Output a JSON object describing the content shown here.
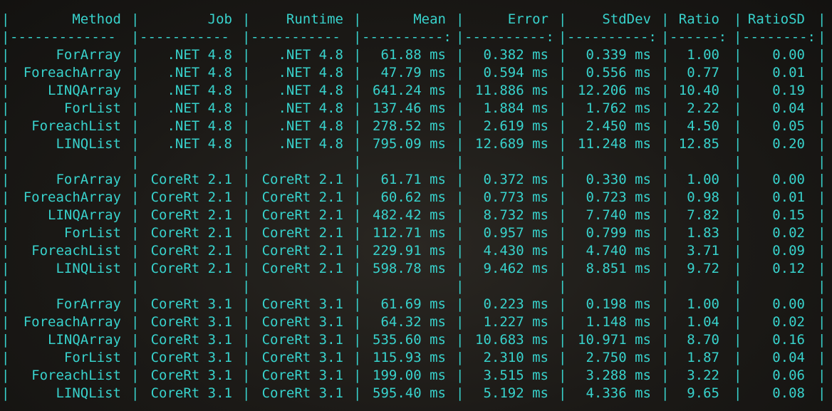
{
  "accent_color": "#38d2cc",
  "columns": [
    {
      "key": "method",
      "label": "Method",
      "separator": "-------------"
    },
    {
      "key": "job",
      "label": "Job",
      "separator": "-----------"
    },
    {
      "key": "runtime",
      "label": "Runtime",
      "separator": "-----------"
    },
    {
      "key": "mean",
      "label": "Mean",
      "separator": "----------:"
    },
    {
      "key": "error",
      "label": "Error",
      "separator": "----------:"
    },
    {
      "key": "stddev",
      "label": "StdDev",
      "separator": "----------:"
    },
    {
      "key": "ratio",
      "label": "Ratio",
      "separator": "------:"
    },
    {
      "key": "ratiosd",
      "label": "RatioSD",
      "separator": "--------:"
    }
  ],
  "groups": [
    {
      "rows": [
        {
          "method": "ForArray",
          "job": ".NET 4.8",
          "runtime": ".NET 4.8",
          "mean": "61.88 ms",
          "error": "0.382 ms",
          "stddev": "0.339 ms",
          "ratio": "1.00",
          "ratiosd": "0.00"
        },
        {
          "method": "ForeachArray",
          "job": ".NET 4.8",
          "runtime": ".NET 4.8",
          "mean": "47.79 ms",
          "error": "0.594 ms",
          "stddev": "0.556 ms",
          "ratio": "0.77",
          "ratiosd": "0.01"
        },
        {
          "method": "LINQArray",
          "job": ".NET 4.8",
          "runtime": ".NET 4.8",
          "mean": "641.24 ms",
          "error": "11.886 ms",
          "stddev": "12.206 ms",
          "ratio": "10.40",
          "ratiosd": "0.19"
        },
        {
          "method": "ForList",
          "job": ".NET 4.8",
          "runtime": ".NET 4.8",
          "mean": "137.46 ms",
          "error": "1.884 ms",
          "stddev": "1.762 ms",
          "ratio": "2.22",
          "ratiosd": "0.04"
        },
        {
          "method": "ForeachList",
          "job": ".NET 4.8",
          "runtime": ".NET 4.8",
          "mean": "278.52 ms",
          "error": "2.619 ms",
          "stddev": "2.450 ms",
          "ratio": "4.50",
          "ratiosd": "0.05"
        },
        {
          "method": "LINQList",
          "job": ".NET 4.8",
          "runtime": ".NET 4.8",
          "mean": "795.09 ms",
          "error": "12.689 ms",
          "stddev": "11.248 ms",
          "ratio": "12.85",
          "ratiosd": "0.20"
        }
      ]
    },
    {
      "rows": [
        {
          "method": "ForArray",
          "job": "CoreRt 2.1",
          "runtime": "CoreRt 2.1",
          "mean": "61.71 ms",
          "error": "0.372 ms",
          "stddev": "0.330 ms",
          "ratio": "1.00",
          "ratiosd": "0.00"
        },
        {
          "method": "ForeachArray",
          "job": "CoreRt 2.1",
          "runtime": "CoreRt 2.1",
          "mean": "60.62 ms",
          "error": "0.773 ms",
          "stddev": "0.723 ms",
          "ratio": "0.98",
          "ratiosd": "0.01"
        },
        {
          "method": "LINQArray",
          "job": "CoreRt 2.1",
          "runtime": "CoreRt 2.1",
          "mean": "482.42 ms",
          "error": "8.732 ms",
          "stddev": "7.740 ms",
          "ratio": "7.82",
          "ratiosd": "0.15"
        },
        {
          "method": "ForList",
          "job": "CoreRt 2.1",
          "runtime": "CoreRt 2.1",
          "mean": "112.71 ms",
          "error": "0.957 ms",
          "stddev": "0.799 ms",
          "ratio": "1.83",
          "ratiosd": "0.02"
        },
        {
          "method": "ForeachList",
          "job": "CoreRt 2.1",
          "runtime": "CoreRt 2.1",
          "mean": "229.91 ms",
          "error": "4.430 ms",
          "stddev": "4.740 ms",
          "ratio": "3.71",
          "ratiosd": "0.09"
        },
        {
          "method": "LINQList",
          "job": "CoreRt 2.1",
          "runtime": "CoreRt 2.1",
          "mean": "598.78 ms",
          "error": "9.462 ms",
          "stddev": "8.851 ms",
          "ratio": "9.72",
          "ratiosd": "0.12"
        }
      ]
    },
    {
      "rows": [
        {
          "method": "ForArray",
          "job": "CoreRt 3.1",
          "runtime": "CoreRt 3.1",
          "mean": "61.69 ms",
          "error": "0.223 ms",
          "stddev": "0.198 ms",
          "ratio": "1.00",
          "ratiosd": "0.00"
        },
        {
          "method": "ForeachArray",
          "job": "CoreRt 3.1",
          "runtime": "CoreRt 3.1",
          "mean": "64.32 ms",
          "error": "1.227 ms",
          "stddev": "1.148 ms",
          "ratio": "1.04",
          "ratiosd": "0.02"
        },
        {
          "method": "LINQArray",
          "job": "CoreRt 3.1",
          "runtime": "CoreRt 3.1",
          "mean": "535.60 ms",
          "error": "10.683 ms",
          "stddev": "10.971 ms",
          "ratio": "8.70",
          "ratiosd": "0.16"
        },
        {
          "method": "ForList",
          "job": "CoreRt 3.1",
          "runtime": "CoreRt 3.1",
          "mean": "115.93 ms",
          "error": "2.310 ms",
          "stddev": "2.750 ms",
          "ratio": "1.87",
          "ratiosd": "0.04"
        },
        {
          "method": "ForeachList",
          "job": "CoreRt 3.1",
          "runtime": "CoreRt 3.1",
          "mean": "199.00 ms",
          "error": "3.515 ms",
          "stddev": "3.288 ms",
          "ratio": "3.22",
          "ratiosd": "0.06"
        },
        {
          "method": "LINQList",
          "job": "CoreRt 3.1",
          "runtime": "CoreRt 3.1",
          "mean": "595.40 ms",
          "error": "5.192 ms",
          "stddev": "4.336 ms",
          "ratio": "9.65",
          "ratiosd": "0.08"
        }
      ]
    }
  ]
}
